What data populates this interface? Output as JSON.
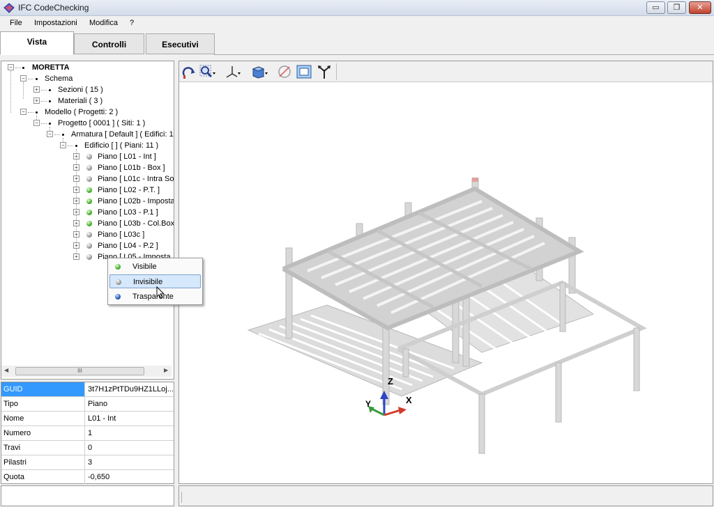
{
  "window": {
    "title": "IFC CodeChecking",
    "minimize": "▭",
    "restore": "❐",
    "close": "✕"
  },
  "menu": [
    "File",
    "Impostazioni",
    "Modifica",
    "?"
  ],
  "tabs": [
    {
      "label": "Vista",
      "active": true
    },
    {
      "label": "Controlli",
      "active": false
    },
    {
      "label": "Esecutivi",
      "active": false
    }
  ],
  "tree": [
    {
      "label": "MORETTA",
      "bold": true
    },
    {
      "label": "Schema"
    },
    {
      "label": "Sezioni ( 15 )"
    },
    {
      "label": "Materiali ( 3 )"
    },
    {
      "label": "Modello ( Progetti: 2 )"
    },
    {
      "label": "Progetto [ 0001 ] ( Siti: 1 )"
    },
    {
      "label": "Armatura [ Default ] ( Edifici: 1"
    },
    {
      "label": "Edificio [ ] ( Piani: 11 )"
    },
    {
      "label": "Piano [ L01 - Int ]",
      "state": "gray"
    },
    {
      "label": "Piano [ L01b - Box ]",
      "state": "gray"
    },
    {
      "label": "Piano [ L01c - Intra So",
      "state": "gray"
    },
    {
      "label": "Piano [ L02 - P.T. ]",
      "state": "green"
    },
    {
      "label": "Piano [ L02b - Imposta",
      "state": "green"
    },
    {
      "label": "Piano [ L03 - P.1 ]",
      "state": "green"
    },
    {
      "label": "Piano [ L03b - Col.Box",
      "state": "green"
    },
    {
      "label": "Piano [ L03c ]",
      "state": "gray"
    },
    {
      "label": "Piano [ L04 - P.2 ]",
      "state": "gray"
    },
    {
      "label": "Piano [ L05 - Imposta",
      "state": "gray"
    }
  ],
  "context_menu": [
    {
      "label": "Visibile",
      "state": "green"
    },
    {
      "label": "Invisibile",
      "state": "gray",
      "highlighted": true
    },
    {
      "label": "Trasparente",
      "state": "blue"
    }
  ],
  "properties": [
    {
      "key": "GUID",
      "value": "3t7H1zPtTDu9HZ1LLoj...",
      "selected": true
    },
    {
      "key": "Tipo",
      "value": "Piano"
    },
    {
      "key": "Nome",
      "value": "L01 - Int"
    },
    {
      "key": "Numero",
      "value": "1"
    },
    {
      "key": "Travi",
      "value": "0"
    },
    {
      "key": "Pilastri",
      "value": "3"
    },
    {
      "key": "Quota",
      "value": "-0,650"
    }
  ],
  "axes": {
    "z": "Z",
    "y": "Y",
    "x": "X"
  },
  "toolbar_icons": [
    "rotate-icon",
    "zoom-icon",
    "axes-icon",
    "views-icon",
    "section-plane-icon",
    "fit-view-icon",
    "split-arrows-icon"
  ]
}
